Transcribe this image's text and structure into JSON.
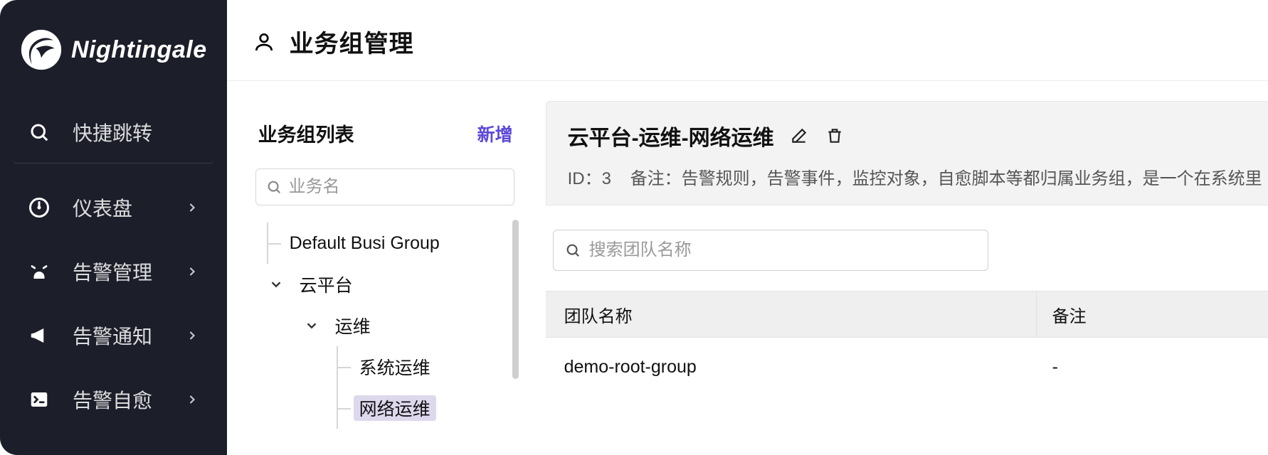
{
  "brand": "Nightingale",
  "nav": {
    "search": "快捷跳转",
    "items": [
      {
        "icon": "gauge-icon",
        "label": "仪表盘"
      },
      {
        "icon": "alarm-icon",
        "label": "告警管理"
      },
      {
        "icon": "megaphone-icon",
        "label": "告警通知"
      },
      {
        "icon": "terminal-icon",
        "label": "告警自愈"
      }
    ]
  },
  "page": {
    "title": "业务组管理"
  },
  "list": {
    "title": "业务组列表",
    "add": "新增",
    "search_placeholder": "业务名",
    "tree": [
      {
        "depth": 0,
        "toggle": null,
        "label": "Default Busi Group"
      },
      {
        "depth": 1,
        "toggle": "open",
        "label": "云平台"
      },
      {
        "depth": 2,
        "toggle": "open",
        "label": "运维"
      },
      {
        "depth": 3,
        "toggle": null,
        "label": "系统运维"
      },
      {
        "depth": 3,
        "toggle": null,
        "label": "网络运维",
        "selected": true
      }
    ]
  },
  "detail": {
    "title": "云平台-运维-网络运维",
    "id_label": "ID：",
    "id_value": "3",
    "note_label": "备注：",
    "note_value": "告警规则，告警事件，监控对象，自愈脚本等都归属业务组，是一个在系统里",
    "search_placeholder": "搜索团队名称",
    "table": {
      "columns": [
        "团队名称",
        "备注"
      ],
      "rows": [
        {
          "name": "demo-root-group",
          "note": "-"
        }
      ]
    }
  }
}
